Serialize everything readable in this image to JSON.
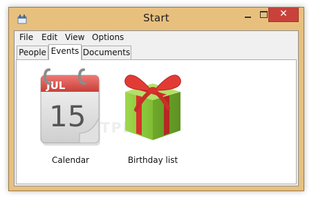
{
  "window": {
    "title": "Start"
  },
  "title_controls": {
    "minimize_glyph": "–",
    "maximize_glyph": "☐",
    "close_glyph": "✕"
  },
  "menu": {
    "items": [
      "File",
      "Edit",
      "View",
      "Options"
    ]
  },
  "tabs": {
    "items": [
      "People",
      "Events",
      "Documents"
    ],
    "selected": "Events"
  },
  "items": [
    {
      "label": "Calendar",
      "icon": "calendar-icon",
      "month": "JUL",
      "day": "15"
    },
    {
      "label": "Birthday list",
      "icon": "gift-box-icon"
    }
  ],
  "watermark": "SOFTPEDIA",
  "colors": {
    "title_bar": "#e8c07e",
    "close_button": "#c8423b",
    "calendar_red": "#d94b46",
    "gift_green": "#8dcc3a",
    "gift_ribbon": "#d8312c"
  }
}
